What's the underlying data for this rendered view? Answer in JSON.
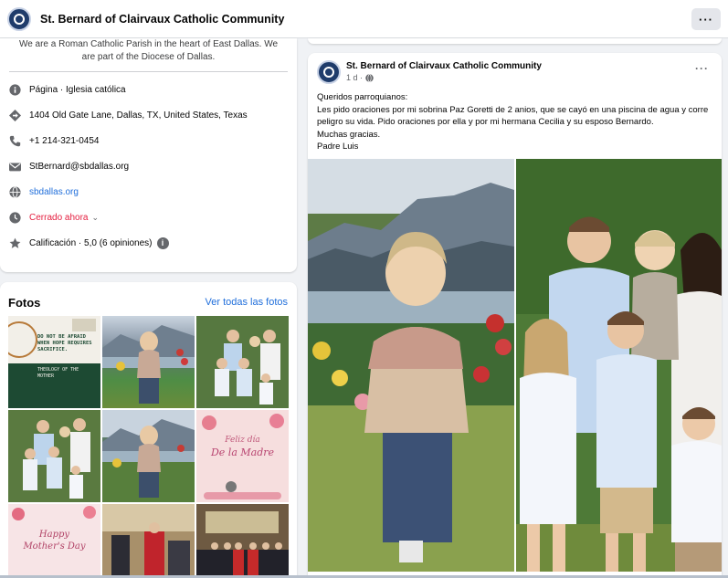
{
  "header": {
    "page_name": "St. Bernard of Clairvaux Catholic Community",
    "more_label": "···"
  },
  "intro": {
    "description": "We are a Roman Catholic Parish in the heart of East Dallas. We are part of the Diocese of Dallas.",
    "category": "Página · Iglesia católica",
    "address": "1404 Old Gate Lane, Dallas, TX, United States, Texas",
    "phone": "+1 214-321-0454",
    "email": "StBernard@sbdallas.org",
    "website": "sbdallas.org",
    "hours_status": "Cerrado ahora",
    "rating": "Calificación · 5,0 (6 opiniones)",
    "info_badge": "i"
  },
  "photos": {
    "title": "Fotos",
    "see_all": "Ver todas las fotos",
    "tile1_lines": [
      "DO NOT BE AFRAID",
      "WHEN HOPE REQUIRES",
      "SACRIFICE."
    ],
    "tile1_sub": "THEOLOGY OF THE",
    "tile1_sub2": "MOTHER",
    "tile6_line1": "Feliz día",
    "tile6_line2": "De la Madre",
    "tile7_line1": "Happy",
    "tile7_line2": "Mother's Day"
  },
  "post": {
    "author": "St. Bernard of Clairvaux Catholic Community",
    "time": "1 d ·",
    "more_label": "···",
    "lines": [
      "Queridos parroquianos:",
      "Les pido oraciones por mi sobrina Paz Goretti de 2 anios, que se cayó en una piscina de agua y corre peligro su vida. Pido oraciones por ella y por mi hermana Cecilia y su esposo Bernardo.",
      "Muchas gracias.",
      "Padre Luis"
    ]
  },
  "colors": {
    "link": "#216fdb",
    "closed": "#e41e3f",
    "background": "#f0f2f5"
  }
}
